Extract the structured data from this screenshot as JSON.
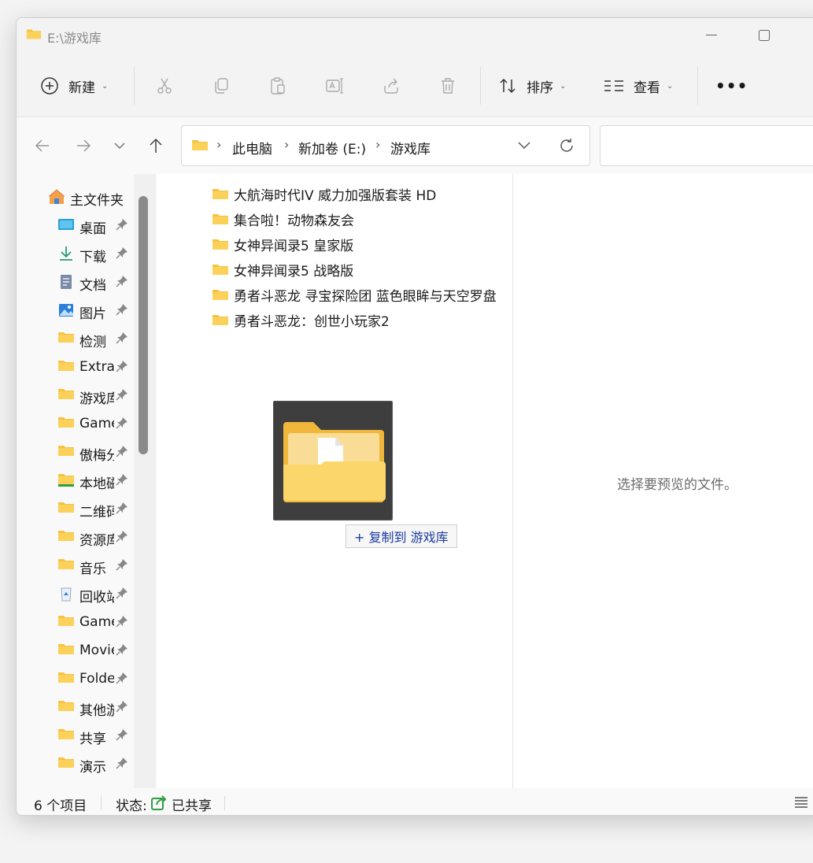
{
  "window": {
    "title": "E:\\游戏库"
  },
  "toolbar": {
    "new_label": "新建",
    "sort_label": "排序",
    "view_label": "查看",
    "more_label": "•••"
  },
  "address": {
    "crumbs": [
      "此电脑",
      "新加卷 (E:)",
      "游戏库"
    ]
  },
  "sidebar": {
    "home_label": "主文件夹",
    "items": [
      {
        "label": "桌面",
        "icon": "desktop-icon"
      },
      {
        "label": "下载",
        "icon": "download-icon"
      },
      {
        "label": "文档",
        "icon": "document-icon"
      },
      {
        "label": "图片",
        "icon": "picture-icon"
      },
      {
        "label": "检测",
        "icon": "folder-icon"
      },
      {
        "label": "Extra",
        "icon": "folder-icon"
      },
      {
        "label": "游戏库",
        "icon": "folder-icon"
      },
      {
        "label": "Games",
        "icon": "folder-icon"
      },
      {
        "label": "傲梅分",
        "icon": "folder-icon"
      },
      {
        "label": "本地磁",
        "icon": "drive-icon"
      },
      {
        "label": "二维码",
        "icon": "folder-icon"
      },
      {
        "label": "资源库",
        "icon": "folder-icon"
      },
      {
        "label": "音乐",
        "icon": "folder-icon"
      },
      {
        "label": "回收站",
        "icon": "recycle-bin-icon"
      },
      {
        "label": "Games",
        "icon": "folder-icon"
      },
      {
        "label": "Movies",
        "icon": "folder-icon"
      },
      {
        "label": "Folder",
        "icon": "folder-icon"
      },
      {
        "label": "其他游",
        "icon": "folder-icon"
      },
      {
        "label": "共享",
        "icon": "folder-icon"
      },
      {
        "label": "演示",
        "icon": "folder-icon"
      }
    ]
  },
  "files": [
    "大航海时代IV 威力加强版套装 HD",
    "集合啦！动物森友会",
    "女神异闻录5 皇家版",
    "女神异闻录5 战略版",
    "勇者斗恶龙 寻宝探险团 蓝色眼眸与天空罗盘",
    "勇者斗恶龙：创世小玩家2"
  ],
  "drag": {
    "tip": "+ 复制到 游戏库"
  },
  "preview": {
    "message": "选择要预览的文件。"
  },
  "status": {
    "count": "6 个项目",
    "state_label": "状态:",
    "state_value": "已共享"
  },
  "colors": {
    "folder": "#f5c242",
    "folder_dark": "#e6a817",
    "accent": "#0067c0",
    "link": "#1b3b9b"
  }
}
